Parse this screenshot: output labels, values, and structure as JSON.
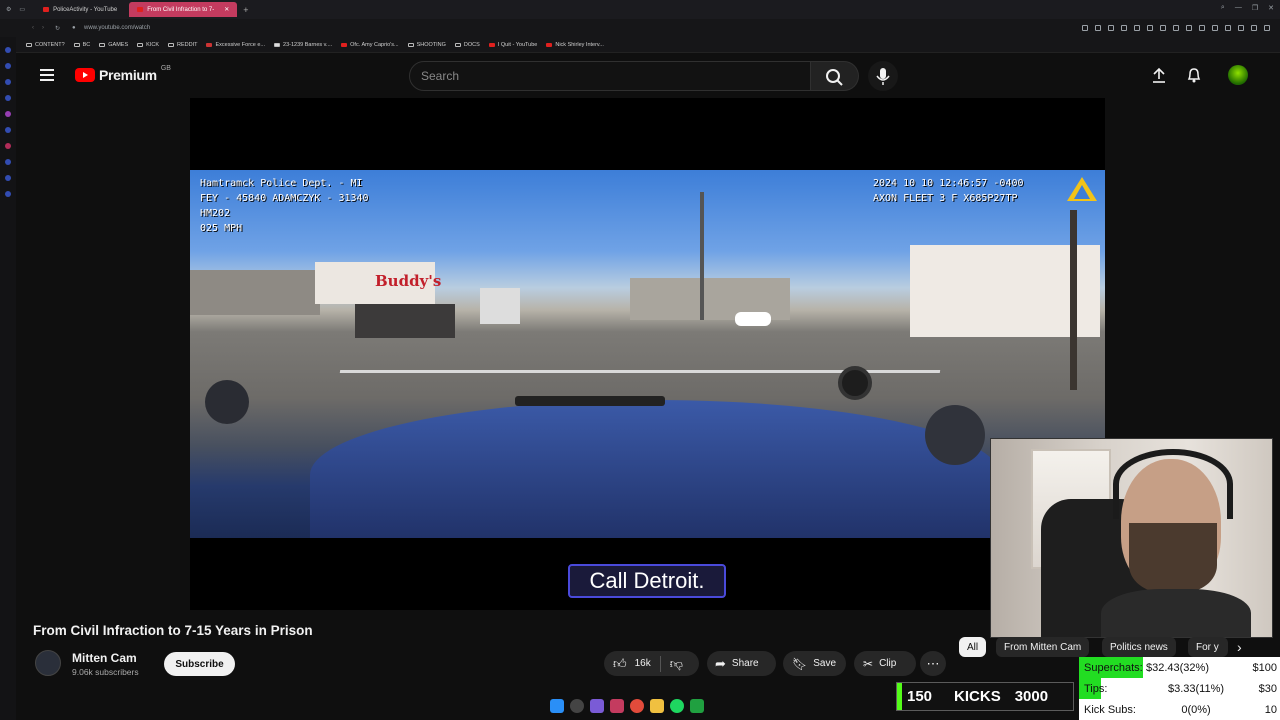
{
  "browser": {
    "tabs": [
      {
        "label": "PoliceActivity - YouTube",
        "active": false
      },
      {
        "label": "From Civil Infraction to 7-",
        "active": true
      }
    ],
    "url": "www.youtube.com/watch",
    "bookmarks": [
      {
        "label": "CONTENT?",
        "icon": "folder-icon"
      },
      {
        "label": "BC",
        "icon": "folder-icon"
      },
      {
        "label": "GAMES",
        "icon": "folder-icon"
      },
      {
        "label": "KICK",
        "icon": "folder-icon"
      },
      {
        "label": "REDDIT",
        "icon": "folder-icon"
      },
      {
        "label": "Excessive Force e...",
        "icon": "flag-icon"
      },
      {
        "label": "23-1239 Barnes v....",
        "icon": "doc-icon"
      },
      {
        "label": "Ofc. Amy Caprio's...",
        "icon": "youtube-icon"
      },
      {
        "label": "SHOOTING",
        "icon": "folder-icon"
      },
      {
        "label": "DOCS",
        "icon": "folder-icon"
      },
      {
        "label": "I Quit - YouTube",
        "icon": "youtube-icon"
      },
      {
        "label": "Nick Shirley Interv...",
        "icon": "youtube-icon"
      }
    ]
  },
  "youtube": {
    "brand": "Premium",
    "region": "GB",
    "search_placeholder": "Search"
  },
  "video": {
    "osd_left": "Hamtramck Police Dept. - MI\nFEY - 45840 ADAMCZYK - 31340\nHM202\n025 MPH",
    "osd_right": "2024 10 10 12:46:57 -0400\nAXON FLEET 3 F X685P27TP",
    "sign_text": "Buddy's",
    "caption": "Call Detroit.",
    "title": "From Civil Infraction to 7-15 Years in Prison",
    "channel": "Mitten Cam",
    "subscribers": "9.06k subscribers",
    "subscribe_label": "Subscribe",
    "likes": "16k",
    "share_label": "Share",
    "save_label": "Save",
    "clip_label": "Clip"
  },
  "chips": [
    "All",
    "From Mitten Cam",
    "Politics news",
    "For y"
  ],
  "overlay": {
    "kicks_count": "150",
    "kicks_label": "KICKS",
    "kicks_goal": "3000",
    "stats": [
      {
        "label": "Superchats:",
        "amount": "$32.43(32%)",
        "goal": "$100",
        "fraction": 0.32
      },
      {
        "label": "Tips:",
        "amount": "$3.33(11%)",
        "goal": "$30",
        "fraction": 0.11
      },
      {
        "label": "Kick Subs:",
        "amount": "0(0%)",
        "goal": "10",
        "fraction": 0
      }
    ]
  },
  "colors": {
    "accent": "#ff0000",
    "kick_green": "#53fc18",
    "tab_active": "#c43b5f"
  }
}
